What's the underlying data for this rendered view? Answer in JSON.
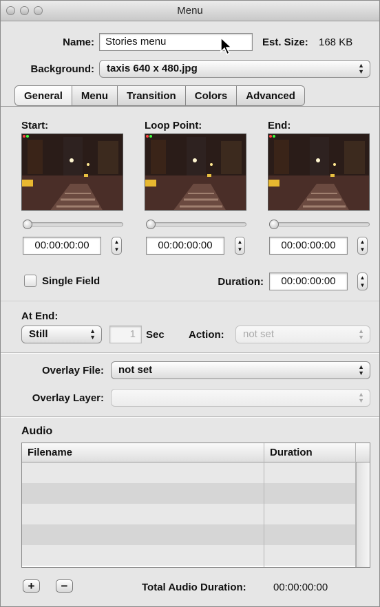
{
  "window": {
    "title": "Menu"
  },
  "header": {
    "name_label": "Name:",
    "name_value": "Stories menu",
    "est_size_label": "Est. Size:",
    "est_size_value": "168 KB",
    "background_label": "Background:",
    "background_value": "taxis 640 x 480.jpg"
  },
  "tabs": [
    {
      "label": "General",
      "active": true
    },
    {
      "label": "Menu",
      "active": false
    },
    {
      "label": "Transition",
      "active": false
    },
    {
      "label": "Colors",
      "active": false
    },
    {
      "label": "Advanced",
      "active": false
    }
  ],
  "general": {
    "start_label": "Start:",
    "loop_label": "Loop Point:",
    "end_label": "End:",
    "start_time": "00:00:00:00",
    "loop_time": "00:00:00:00",
    "end_time": "00:00:00:00",
    "single_field_label": "Single Field",
    "duration_label": "Duration:",
    "duration_value": "00:00:00:00",
    "at_end_label": "At End:",
    "at_end_value": "Still",
    "sec_value": "1",
    "sec_label": "Sec",
    "action_label": "Action:",
    "action_value": "not set",
    "overlay_file_label": "Overlay File:",
    "overlay_file_value": "not set",
    "overlay_layer_label": "Overlay Layer:",
    "overlay_layer_value": ""
  },
  "audio": {
    "section_title": "Audio",
    "columns": [
      "Filename",
      "Duration"
    ],
    "rows": [],
    "add_label": "+",
    "remove_label": "−",
    "total_label": "Total Audio Duration:",
    "total_value": "00:00:00:00"
  },
  "colors": {
    "window_bg": "#e6e6e6",
    "row_even": "#e8e8e8",
    "row_odd": "#d6d6d6"
  }
}
